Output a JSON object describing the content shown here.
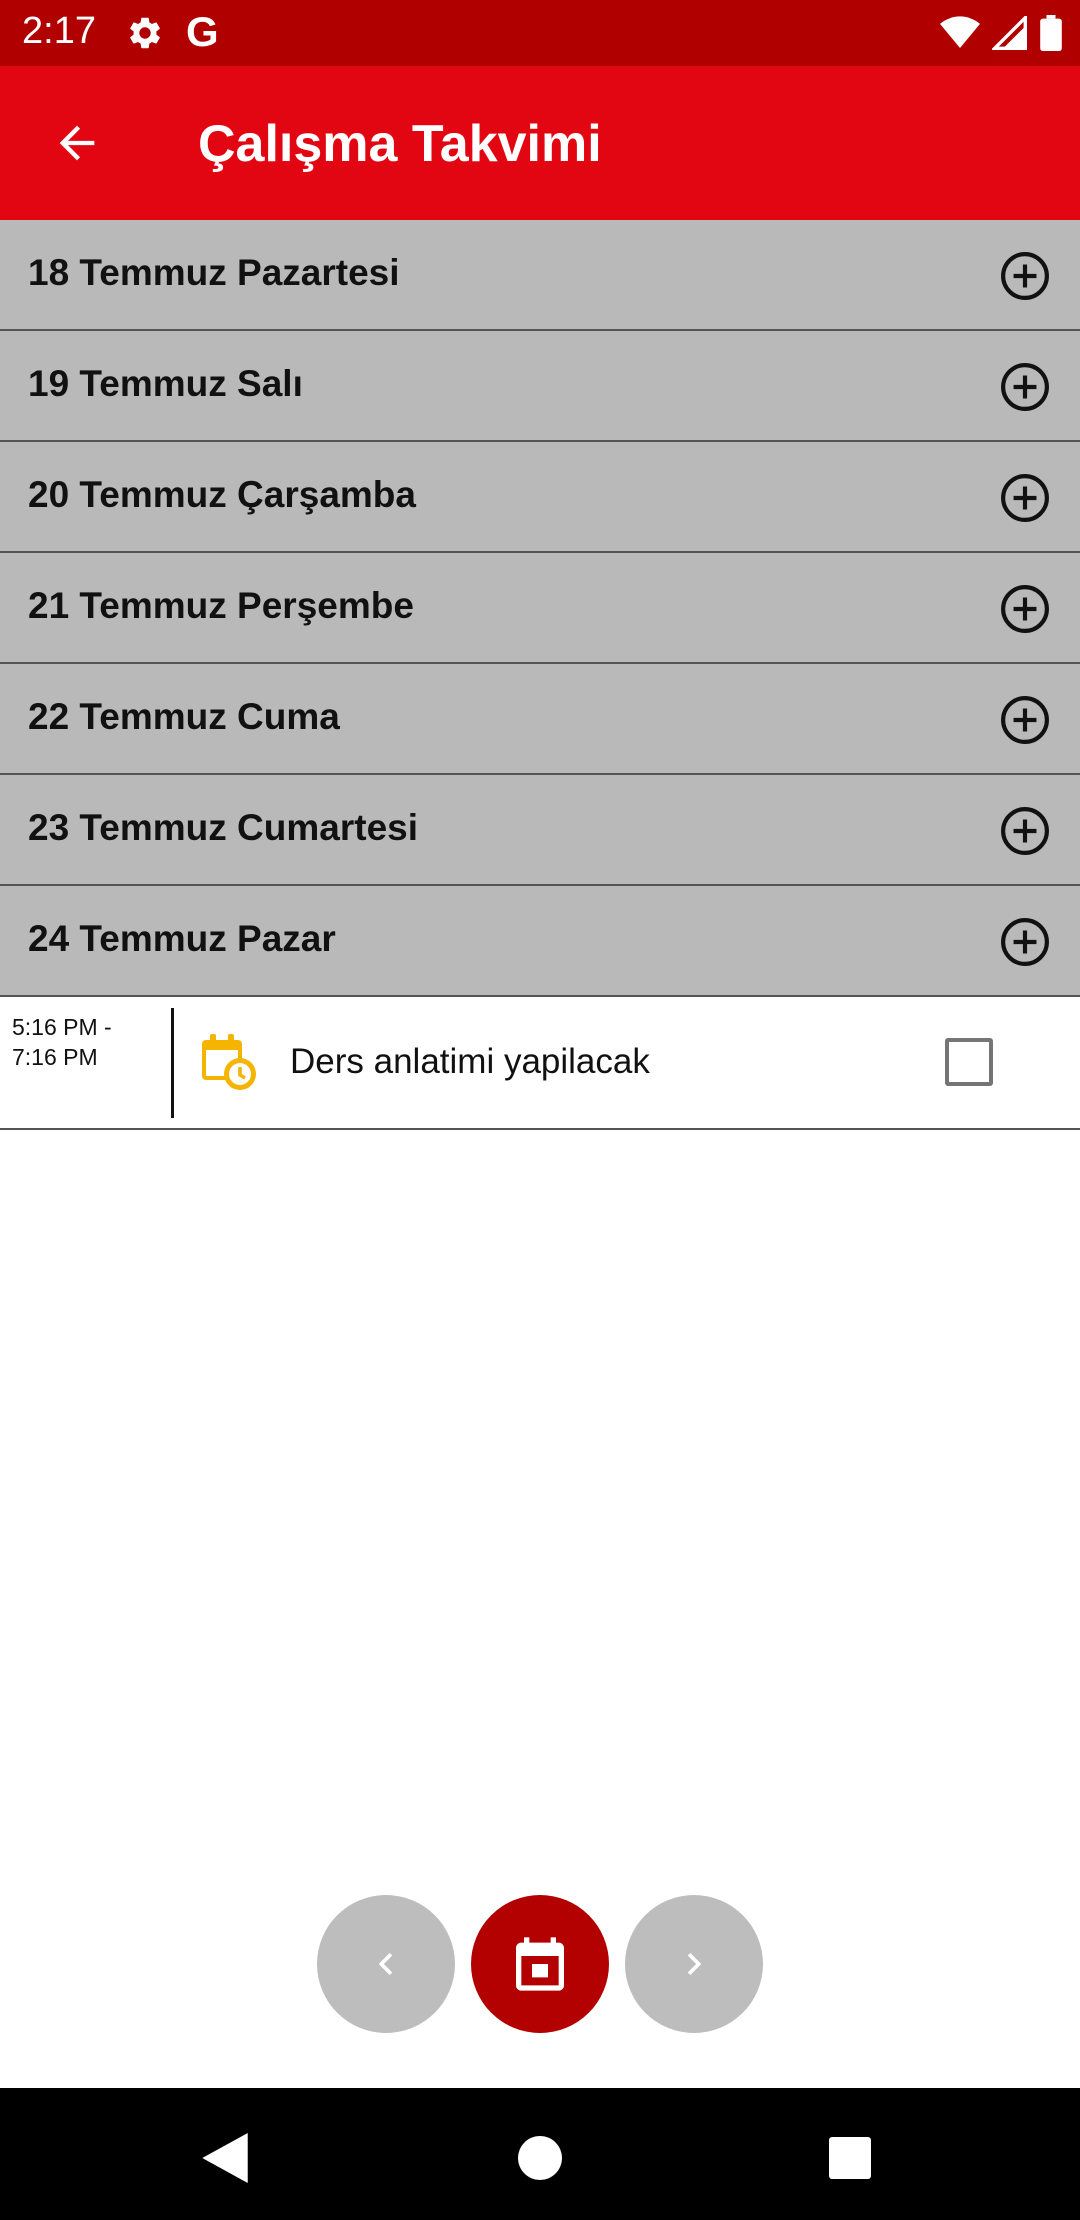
{
  "status_bar": {
    "time": "2:17",
    "icons": [
      "settings-icon",
      "google-g-icon",
      "wifi-icon",
      "signal-icon",
      "battery-icon"
    ],
    "google_letter": "G"
  },
  "app_bar": {
    "title": "Çalışma Takvimi",
    "back_icon": "arrow-back-icon",
    "background": "#e20613"
  },
  "days": [
    {
      "label": "18 Temmuz Pazartesi"
    },
    {
      "label": "19 Temmuz Salı"
    },
    {
      "label": "20 Temmuz Çarşamba"
    },
    {
      "label": "21 Temmuz Perşembe"
    },
    {
      "label": "22 Temmuz Cuma"
    },
    {
      "label": "23 Temmuz Cumartesi"
    },
    {
      "label": "24 Temmuz Pazar"
    }
  ],
  "event": {
    "time_range": "5:16 PM -\n7:16 PM",
    "icon": "calendar-clock-icon",
    "title": "Ders anlatimi yapilacak",
    "checked": false
  },
  "bottom_controls": {
    "prev_icon": "chevron-left-icon",
    "calendar_icon": "calendar-today-icon",
    "next_icon": "chevron-right-icon"
  },
  "colors": {
    "status_bar": "#b00000",
    "day_row": "#b9b9b9",
    "calendar_fab": "#b30000",
    "nav_fab": "#bdbdbd",
    "event_icon": "#f4b400"
  }
}
